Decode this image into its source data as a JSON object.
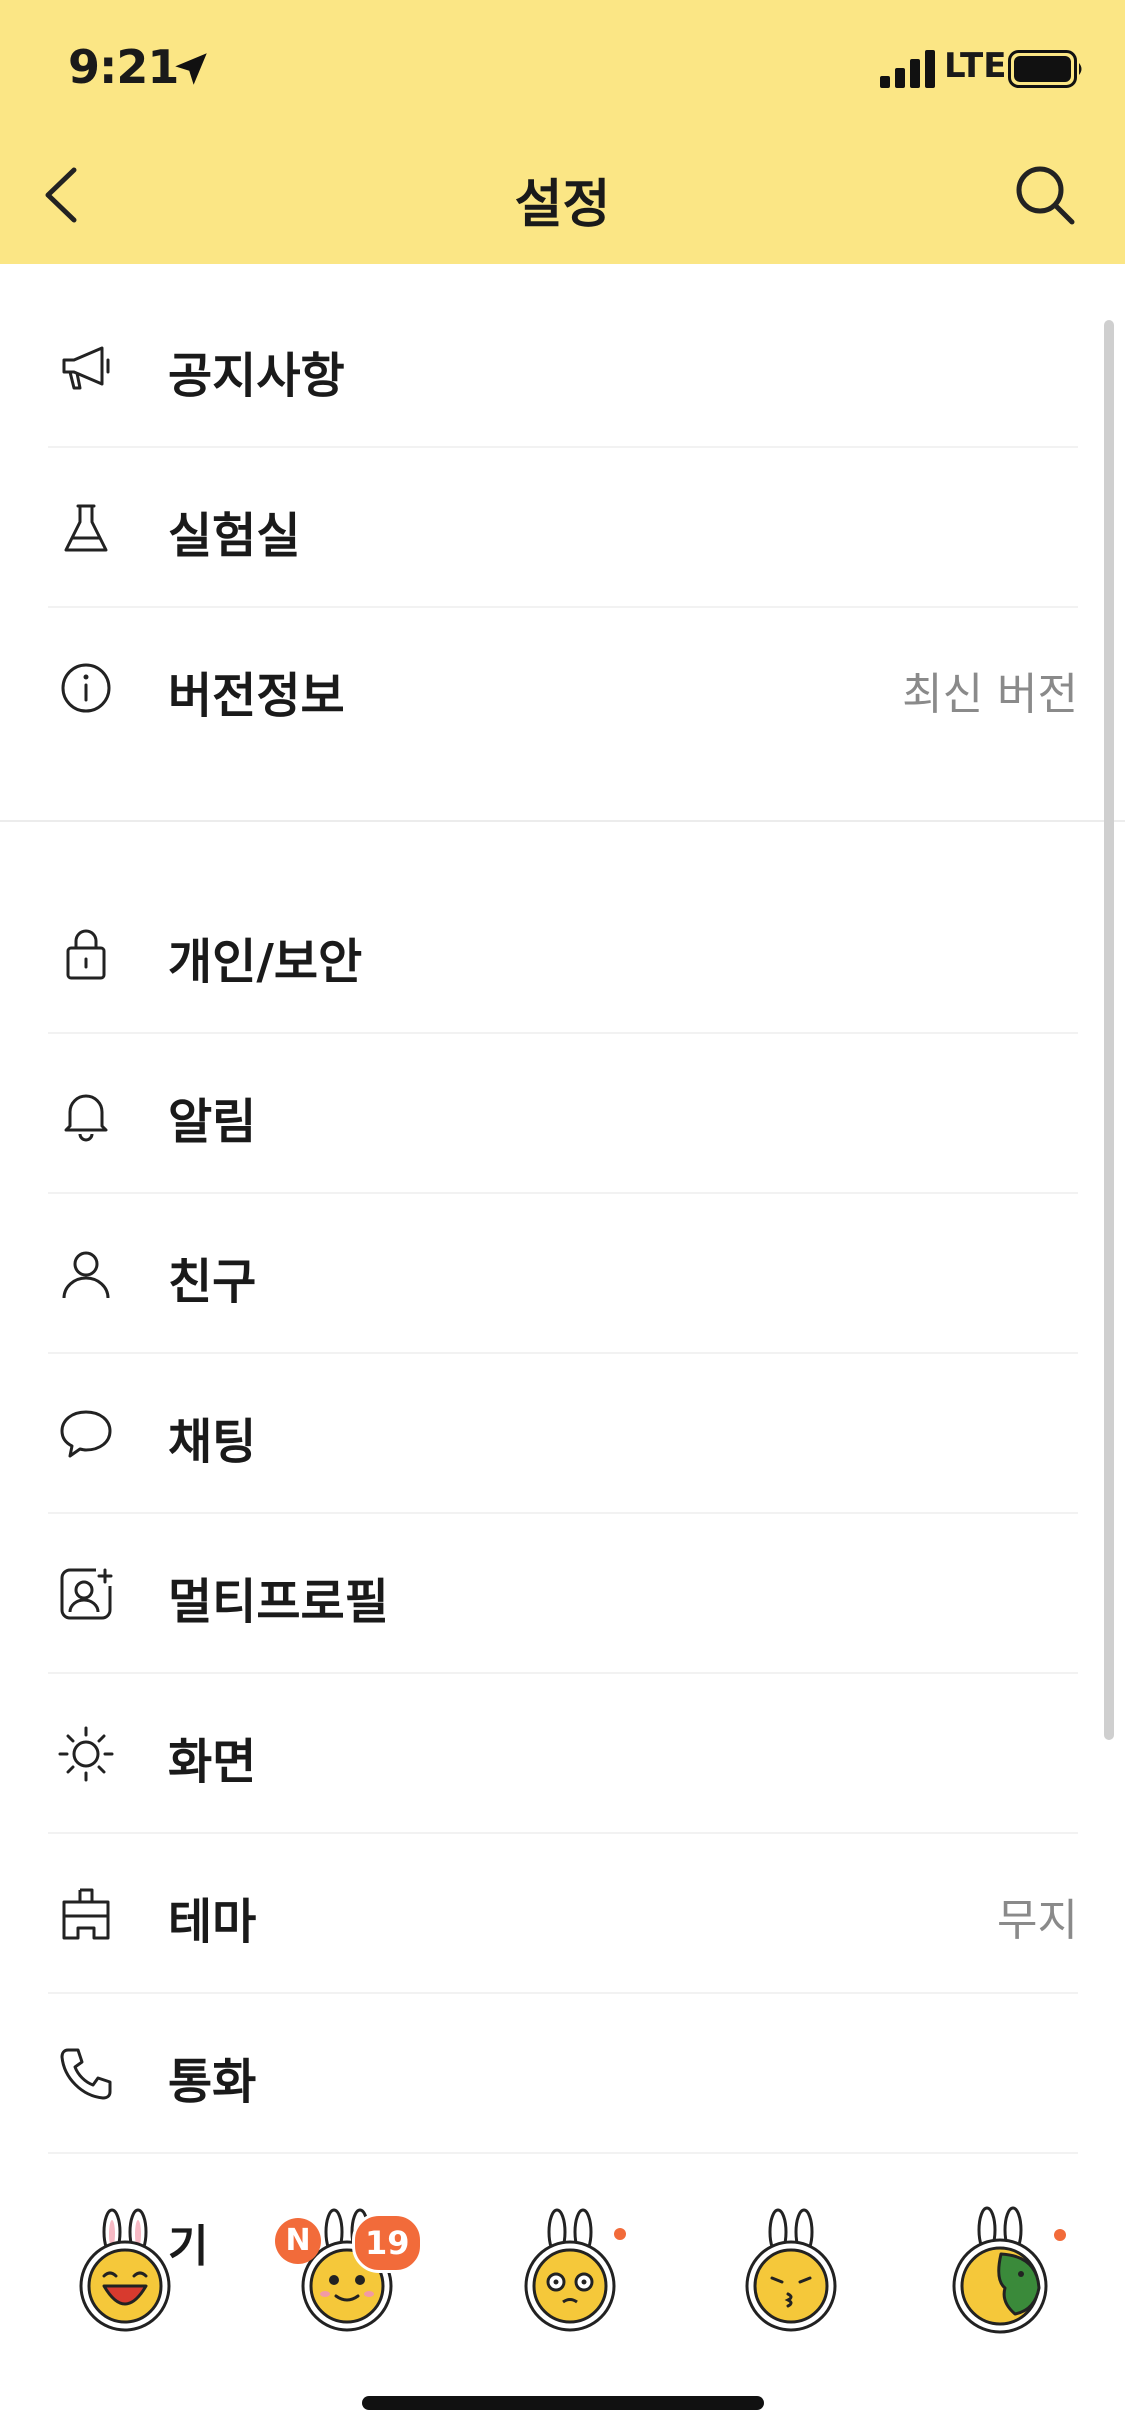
{
  "status_bar": {
    "time": "9:21",
    "network": "LTE"
  },
  "nav": {
    "title": "설정"
  },
  "menu_group_1": [
    {
      "label": "공지사항",
      "icon": "megaphone-icon"
    },
    {
      "label": "실험실",
      "icon": "flask-icon"
    },
    {
      "label": "버전정보",
      "icon": "info-icon",
      "value": "최신 버전"
    }
  ],
  "menu_group_2": [
    {
      "label": "개인/보안",
      "icon": "lock-icon"
    },
    {
      "label": "알림",
      "icon": "bell-icon"
    },
    {
      "label": "친구",
      "icon": "person-icon"
    },
    {
      "label": "채팅",
      "icon": "chat-bubble-icon"
    },
    {
      "label": "멀티프로필",
      "icon": "multi-profile-icon"
    },
    {
      "label": "화면",
      "icon": "brightness-icon"
    },
    {
      "label": "테마",
      "icon": "paint-brush-icon",
      "value": "무지"
    },
    {
      "label": "통화",
      "icon": "phone-icon"
    }
  ],
  "partial_row_label": "기",
  "emoticon_bar": {
    "new_badge": "N",
    "count_badge": "19"
  },
  "colors": {
    "header_bg": "#FBE685",
    "badge": "#F26B3A"
  }
}
